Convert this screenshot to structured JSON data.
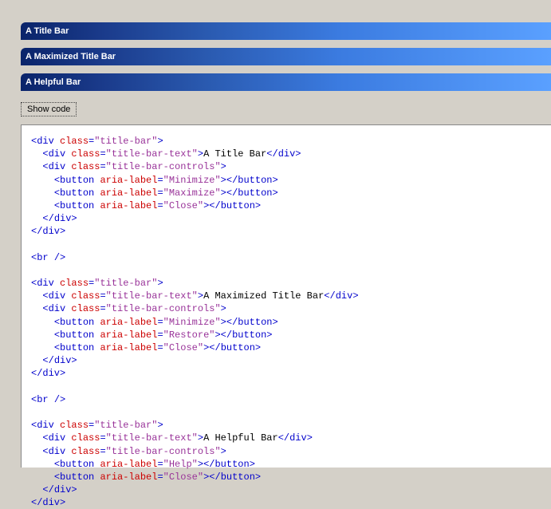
{
  "titleBars": [
    {
      "text": "A Title Bar"
    },
    {
      "text": "A Maximized Title Bar"
    },
    {
      "text": "A Helpful Bar"
    }
  ],
  "showCodeLabel": "Show code",
  "codeLines": [
    {
      "indent": 0,
      "kind": "open",
      "tag": "div",
      "attrs": [
        [
          "class",
          "title-bar"
        ]
      ]
    },
    {
      "indent": 1,
      "kind": "pair",
      "tag": "div",
      "attrs": [
        [
          "class",
          "title-bar-text"
        ]
      ],
      "text": "A Title Bar"
    },
    {
      "indent": 1,
      "kind": "open",
      "tag": "div",
      "attrs": [
        [
          "class",
          "title-bar-controls"
        ]
      ]
    },
    {
      "indent": 2,
      "kind": "pair",
      "tag": "button",
      "attrs": [
        [
          "aria-label",
          "Minimize"
        ]
      ],
      "text": ""
    },
    {
      "indent": 2,
      "kind": "pair",
      "tag": "button",
      "attrs": [
        [
          "aria-label",
          "Maximize"
        ]
      ],
      "text": ""
    },
    {
      "indent": 2,
      "kind": "pair",
      "tag": "button",
      "attrs": [
        [
          "aria-label",
          "Close"
        ]
      ],
      "text": ""
    },
    {
      "indent": 1,
      "kind": "close",
      "tag": "div"
    },
    {
      "indent": 0,
      "kind": "close",
      "tag": "div"
    },
    {
      "indent": 0,
      "kind": "blank"
    },
    {
      "indent": 0,
      "kind": "self",
      "tag": "br"
    },
    {
      "indent": 0,
      "kind": "blank"
    },
    {
      "indent": 0,
      "kind": "open",
      "tag": "div",
      "attrs": [
        [
          "class",
          "title-bar"
        ]
      ]
    },
    {
      "indent": 1,
      "kind": "pair",
      "tag": "div",
      "attrs": [
        [
          "class",
          "title-bar-text"
        ]
      ],
      "text": "A Maximized Title Bar"
    },
    {
      "indent": 1,
      "kind": "open",
      "tag": "div",
      "attrs": [
        [
          "class",
          "title-bar-controls"
        ]
      ]
    },
    {
      "indent": 2,
      "kind": "pair",
      "tag": "button",
      "attrs": [
        [
          "aria-label",
          "Minimize"
        ]
      ],
      "text": ""
    },
    {
      "indent": 2,
      "kind": "pair",
      "tag": "button",
      "attrs": [
        [
          "aria-label",
          "Restore"
        ]
      ],
      "text": ""
    },
    {
      "indent": 2,
      "kind": "pair",
      "tag": "button",
      "attrs": [
        [
          "aria-label",
          "Close"
        ]
      ],
      "text": ""
    },
    {
      "indent": 1,
      "kind": "close",
      "tag": "div"
    },
    {
      "indent": 0,
      "kind": "close",
      "tag": "div"
    },
    {
      "indent": 0,
      "kind": "blank"
    },
    {
      "indent": 0,
      "kind": "self",
      "tag": "br"
    },
    {
      "indent": 0,
      "kind": "blank"
    },
    {
      "indent": 0,
      "kind": "open",
      "tag": "div",
      "attrs": [
        [
          "class",
          "title-bar"
        ]
      ]
    },
    {
      "indent": 1,
      "kind": "pair",
      "tag": "div",
      "attrs": [
        [
          "class",
          "title-bar-text"
        ]
      ],
      "text": "A Helpful Bar"
    },
    {
      "indent": 1,
      "kind": "open",
      "tag": "div",
      "attrs": [
        [
          "class",
          "title-bar-controls"
        ]
      ]
    },
    {
      "indent": 2,
      "kind": "pair",
      "tag": "button",
      "attrs": [
        [
          "aria-label",
          "Help"
        ]
      ],
      "text": ""
    },
    {
      "indent": 2,
      "kind": "pair",
      "tag": "button",
      "attrs": [
        [
          "aria-label",
          "Close"
        ]
      ],
      "text": ""
    },
    {
      "indent": 1,
      "kind": "close",
      "tag": "div"
    },
    {
      "indent": 0,
      "kind": "close",
      "tag": "div"
    }
  ]
}
